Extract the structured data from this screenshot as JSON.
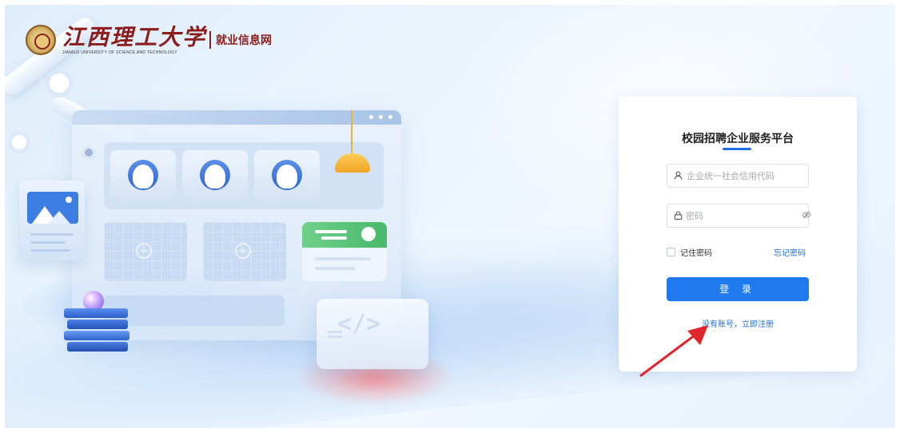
{
  "header": {
    "logo_cn": "江西理工大学",
    "logo_en": "JIANGXI UNIVERSITY OF SCIENCE AND TECHNOLOGY",
    "site_name": "就业信息网"
  },
  "login": {
    "title": "校园招聘企业服务平台",
    "credit_code_placeholder": "企业统一社会信用代码",
    "credit_code_value": "",
    "password_placeholder": "密码",
    "password_value": "",
    "remember_label": "记住密码",
    "forgot_label": "忘记密码",
    "login_button": "登 录",
    "register_link": "没有账号，立即注册"
  },
  "colors": {
    "accent": "#1f7af0",
    "brand": "#8b1d1d",
    "annotation_arrow": "#e0262b"
  },
  "icons": {
    "user": "user-icon",
    "lock": "lock-icon",
    "eye_off": "eye-off-icon"
  }
}
